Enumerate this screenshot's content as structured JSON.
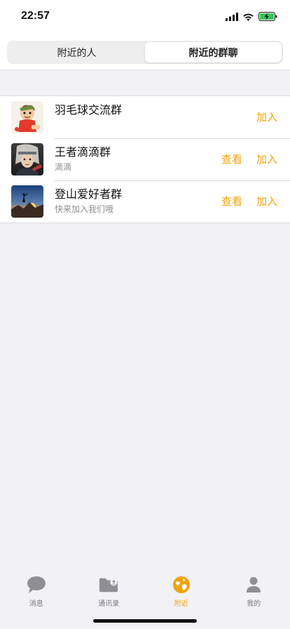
{
  "status_bar": {
    "time": "22:57",
    "icons": [
      "cellular-signal-icon",
      "wifi-icon",
      "battery-charging-icon"
    ],
    "battery_color": "#34c759"
  },
  "segmented": {
    "tabs": [
      {
        "label": "附近的人",
        "active": false
      },
      {
        "label": "附近的群聊",
        "active": true
      }
    ]
  },
  "groups": [
    {
      "name": "羽毛球交流群",
      "description": "",
      "view_label": "",
      "join_label": "加入",
      "avatar": "cartoon-boy-avatar"
    },
    {
      "name": "王者滴滴群",
      "description": "滴滴",
      "view_label": "查看",
      "join_label": "加入",
      "avatar": "game-character-avatar"
    },
    {
      "name": "登山爱好者群",
      "description": "快来加入我们哦",
      "view_label": "查看",
      "join_label": "加入",
      "avatar": "mountain-sunset-avatar"
    }
  ],
  "tab_bar": {
    "items": [
      {
        "label": "消息",
        "icon": "chat-bubble-icon",
        "active": false
      },
      {
        "label": "通讯录",
        "icon": "contacts-folder-icon",
        "active": false
      },
      {
        "label": "附近",
        "icon": "nearby-globe-icon",
        "active": true
      },
      {
        "label": "我的",
        "icon": "person-icon",
        "active": false
      }
    ]
  },
  "colors": {
    "accent": "#f0a30a",
    "background": "#f2f1f6",
    "inactive_tab": "#7a7a7e"
  }
}
